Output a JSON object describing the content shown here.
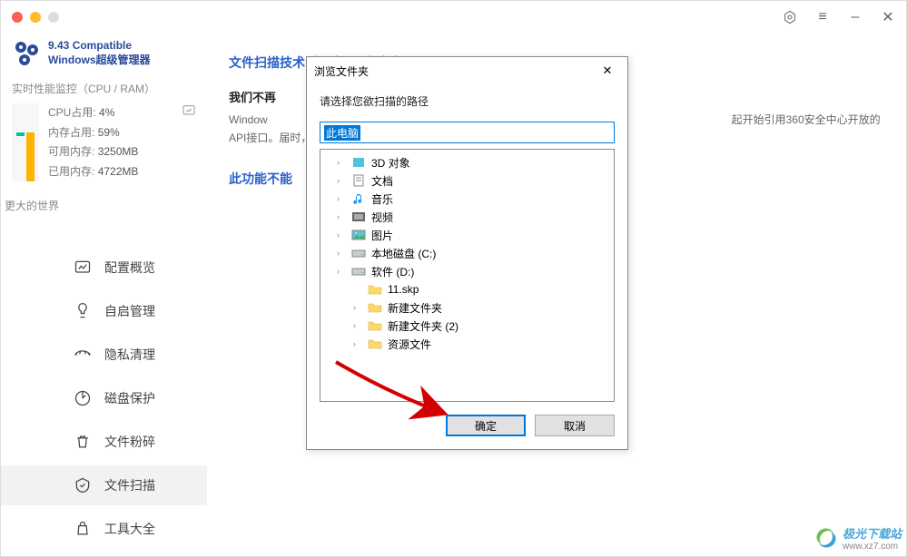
{
  "titlebar": {
    "settings_icon": "⚙",
    "menu_icon": "≡",
    "minimize_icon": "–",
    "close_icon": "✕"
  },
  "app": {
    "title_line1": "9.43 Compatible",
    "title_line2": "Windows超级管理器"
  },
  "perf": {
    "title": "实时性能监控（CPU / RAM）",
    "cpu_label": "CPU占用:",
    "cpu_value": "4%",
    "ram_label": "内存占用:",
    "ram_value": "59%",
    "avail_label": "可用内存:",
    "avail_value": "3250MB",
    "used_label": "已用内存:",
    "used_value": "4722MB"
  },
  "section": {
    "bigger_world": "更大的世界"
  },
  "nav": [
    {
      "key": "overview",
      "label": "配置概览"
    },
    {
      "key": "startup",
      "label": "自启管理"
    },
    {
      "key": "privacy",
      "label": "隐私清理"
    },
    {
      "key": "disk",
      "label": "磁盘保护"
    },
    {
      "key": "shred",
      "label": "文件粉碎"
    },
    {
      "key": "scan",
      "label": "文件扫描"
    },
    {
      "key": "tools",
      "label": "工具大全"
    }
  ],
  "main": {
    "title": "文件扫描技术引用自360安全中心",
    "sub_title": "我们不再",
    "body_prefix": "Window",
    "body_suffix": "起开始引用360安全中心开放的API接口。届时，我们将不再",
    "warn": "此功能不能"
  },
  "dialog": {
    "title": "浏览文件夹",
    "instruction": "请选择您欲扫描的路径",
    "selected_path": "此电脑",
    "ok": "确定",
    "cancel": "取消",
    "tree": [
      {
        "label": "3D 对象",
        "icon": "3d",
        "expandable": true
      },
      {
        "label": "文档",
        "icon": "doc",
        "expandable": true
      },
      {
        "label": "音乐",
        "icon": "music",
        "expandable": true
      },
      {
        "label": "视频",
        "icon": "video",
        "expandable": true
      },
      {
        "label": "图片",
        "icon": "pic",
        "expandable": true
      },
      {
        "label": "本地磁盘 (C:)",
        "icon": "disk",
        "expandable": true
      },
      {
        "label": "软件 (D:)",
        "icon": "disk",
        "expandable": true
      },
      {
        "label": "11.skp",
        "icon": "folder",
        "expandable": false,
        "lvl": 2
      },
      {
        "label": "新建文件夹",
        "icon": "folder",
        "expandable": true,
        "lvl": 2
      },
      {
        "label": "新建文件夹 (2)",
        "icon": "folder",
        "expandable": true,
        "lvl": 2
      },
      {
        "label": "资源文件",
        "icon": "folder",
        "expandable": true,
        "lvl": 2
      }
    ]
  },
  "watermark": {
    "name": "极光下载站",
    "url": "www.xz7.com"
  }
}
